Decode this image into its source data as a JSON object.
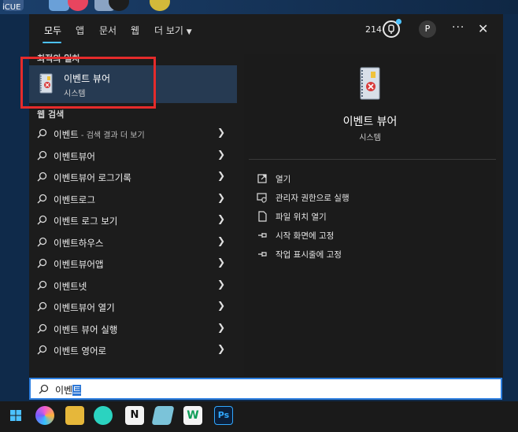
{
  "desktop": {
    "label": "iCUE"
  },
  "tabs": [
    {
      "label": "모두"
    },
    {
      "label": "앱"
    },
    {
      "label": "문서"
    },
    {
      "label": "웹"
    },
    {
      "label": "더 보기"
    }
  ],
  "header": {
    "points": "214",
    "avatar_initial": "P",
    "more": "···",
    "close": "✕"
  },
  "best_match": {
    "section_title": "최적의 일치",
    "title": "이벤트 뷰어",
    "subtitle": "시스템"
  },
  "web_search": {
    "section_title": "웹 검색",
    "items": [
      {
        "label": "이벤트",
        "sub": " - 검색 결과 더 보기"
      },
      {
        "label": "이벤트뷰어",
        "sub": ""
      },
      {
        "label": "이벤트뷰어 로그기록",
        "sub": ""
      },
      {
        "label": "이벤트로그",
        "sub": ""
      },
      {
        "label": "이벤트 로그 보기",
        "sub": ""
      },
      {
        "label": "이벤트하우스",
        "sub": ""
      },
      {
        "label": "이벤트뷰어앱",
        "sub": ""
      },
      {
        "label": "이벤트넷",
        "sub": ""
      },
      {
        "label": "이벤트뷰어 열기",
        "sub": ""
      },
      {
        "label": "이벤트 뷰어 실행",
        "sub": ""
      },
      {
        "label": "이벤트 영어로",
        "sub": ""
      }
    ]
  },
  "detail": {
    "title": "이벤트 뷰어",
    "subtitle": "시스템",
    "actions": [
      {
        "label": "열기",
        "icon": "open-icon"
      },
      {
        "label": "관리자 권한으로 실행",
        "icon": "shield-run-icon"
      },
      {
        "label": "파일 위치 열기",
        "icon": "file-location-icon"
      },
      {
        "label": "시작 화면에 고정",
        "icon": "pin-icon"
      },
      {
        "label": "작업 표시줄에 고정",
        "icon": "pin-taskbar-icon"
      }
    ]
  },
  "search": {
    "typed": "이벤",
    "selected": "트"
  },
  "taskbar": {
    "icons": [
      "windows-start-icon",
      "copilot-icon",
      "file-explorer-icon",
      "app-icon",
      "notion-icon",
      "app-icon-2",
      "word-app-icon",
      "photoshop-icon"
    ]
  },
  "colors": {
    "accent": "#4cc2ff",
    "highlight_box": "#e52b2b",
    "selected_row": "#263a52"
  }
}
